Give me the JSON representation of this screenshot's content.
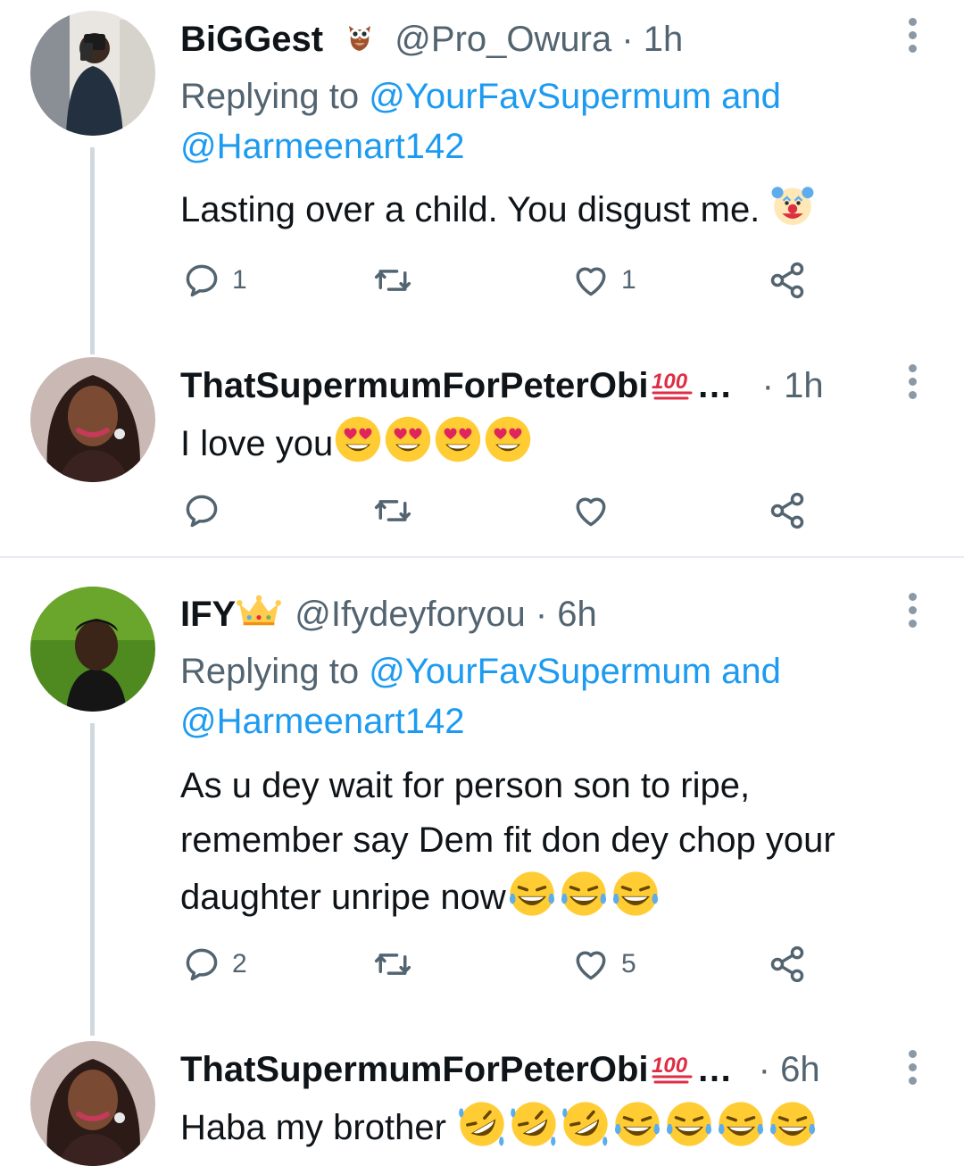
{
  "tweets": [
    {
      "display_name": "BiGGest",
      "name_emoji": "owl-emoji",
      "handle": "@Pro_Owura",
      "time": "· 1h",
      "replying_prefix": "Replying to ",
      "mention1": "@YourFavSupermum",
      "and_word": " and",
      "mention2": "@Harmeenart142",
      "text": "Lasting over a child. You disgust me. ",
      "text_emojis": [
        "clown-face-emoji"
      ],
      "reply_count": "1",
      "retweet_count": "",
      "like_count": "1"
    },
    {
      "display_name": "ThatSupermumForPeterObi",
      "name_suffix": "…",
      "name_emoji": "hundred-points-emoji",
      "time": "· 1h",
      "text": "I love you",
      "text_emojis": [
        "heart-eyes-emoji",
        "heart-eyes-emoji",
        "heart-eyes-emoji",
        "heart-eyes-emoji"
      ],
      "reply_count": "",
      "retweet_count": "",
      "like_count": ""
    },
    {
      "display_name": "IFY",
      "name_emoji": "crown-emoji",
      "handle": "@Ifydeyforyou",
      "time": "· 6h",
      "replying_prefix": "Replying to ",
      "mention1": "@YourFavSupermum",
      "and_word": " and",
      "mention2": "@Harmeenart142",
      "text_line1": "As u dey wait for person son to ripe,",
      "text_line2": "remember say Dem fit don dey chop your",
      "text_line3": "daughter unripe now",
      "text_emojis": [
        "tears-of-joy-emoji",
        "tears-of-joy-emoji",
        "tears-of-joy-emoji"
      ],
      "reply_count": "2",
      "retweet_count": "",
      "like_count": "5"
    },
    {
      "display_name": "ThatSupermumForPeterObi",
      "name_suffix": "…",
      "name_emoji": "hundred-points-emoji",
      "time": "· 6h",
      "text": "Haba my brother ",
      "text_emojis": [
        "rofl-emoji",
        "rofl-emoji",
        "rofl-emoji",
        "tears-of-joy-emoji",
        "tears-of-joy-emoji",
        "tears-of-joy-emoji",
        "tears-of-joy-emoji"
      ]
    }
  ],
  "colors": {
    "text": "#0f1419",
    "muted": "#536471",
    "link": "#1d9bf0",
    "thread_line": "#cfd9de"
  }
}
